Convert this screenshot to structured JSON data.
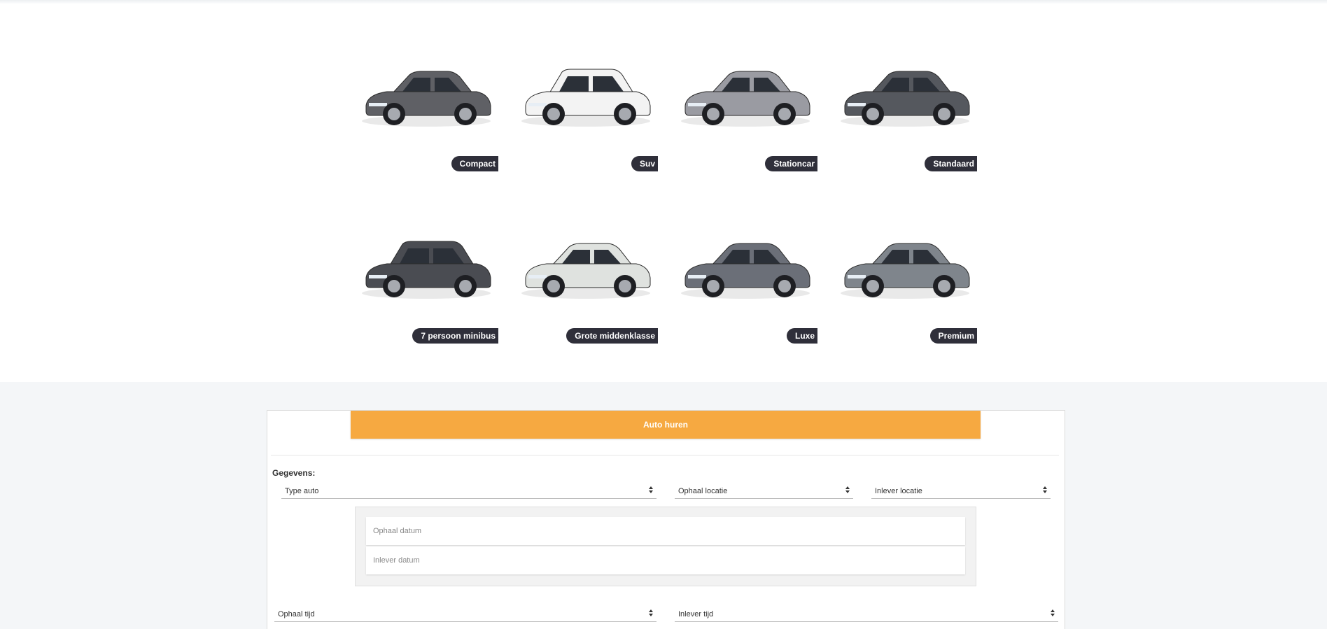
{
  "cars": [
    {
      "label": "Compact",
      "image": "compact-hatchback-image",
      "color": "#5f6065"
    },
    {
      "label": "Suv",
      "image": "suv-image",
      "color": "#f3f3f3"
    },
    {
      "label": "Stationcar",
      "image": "stationcar-image",
      "color": "#9a9ba2"
    },
    {
      "label": "Standaard",
      "image": "standaard-sedan-image",
      "color": "#55585e"
    },
    {
      "label": "7 persoon minibus",
      "image": "minibus-image",
      "color": "#4a4c52"
    },
    {
      "label": "Grote middenklasse",
      "image": "grote-middenklasse-image",
      "color": "#dfe2df"
    },
    {
      "label": "Luxe",
      "image": "luxe-sedan-image",
      "color": "#6b6f78"
    },
    {
      "label": "Premium",
      "image": "premium-sedan-image",
      "color": "#7f858c"
    }
  ],
  "form": {
    "submit_label": "Auto huren",
    "section_label": "Gegevens:",
    "type_auto": "Type auto",
    "ophaal_locatie": "Ophaal locatie",
    "inlever_locatie": "Inlever locatie",
    "ophaal_datum_placeholder": "Ophaal datum",
    "inlever_datum_placeholder": "Inlever datum",
    "ophaal_tijd": "Ophaal tijd",
    "inlever_tijd": "Inlever tijd"
  },
  "colors": {
    "accent": "#f6a941",
    "label_bg": "#2f2f3a",
    "page_bg": "#f4f6f8"
  }
}
